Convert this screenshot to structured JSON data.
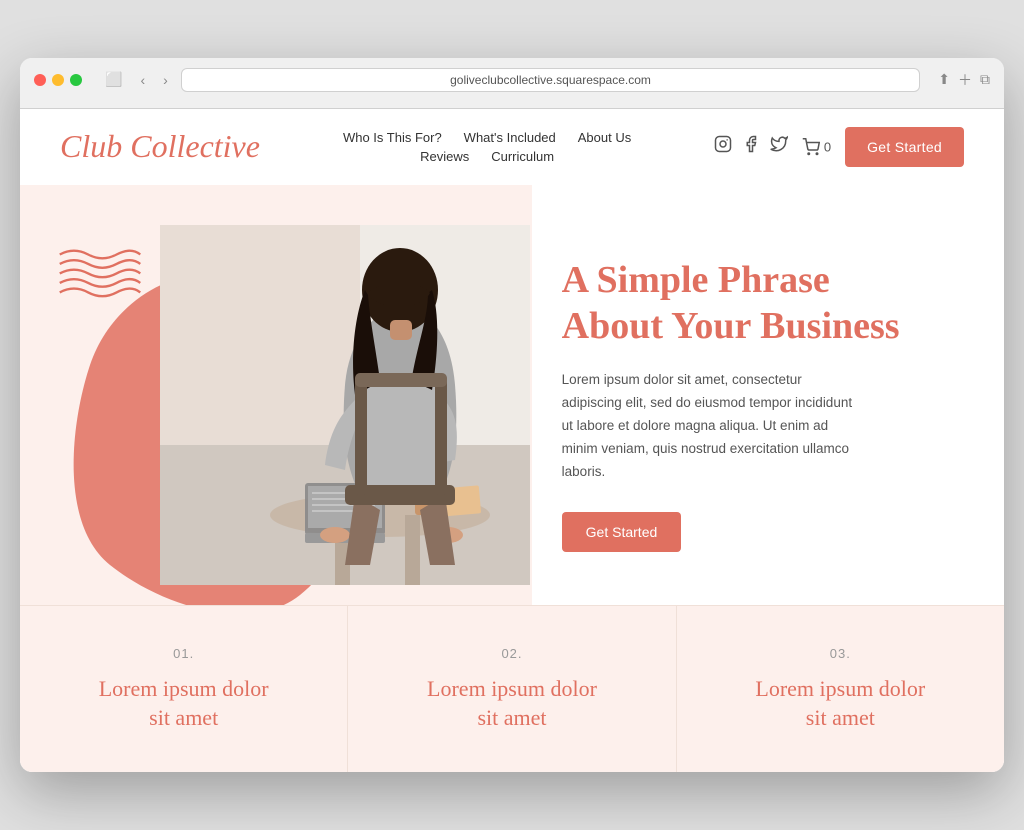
{
  "browser": {
    "url": "goliveclubcollective.squarespace.com",
    "reload_label": "↻"
  },
  "header": {
    "logo": "Club Collective",
    "nav": {
      "row1": [
        {
          "label": "Who Is This For?",
          "id": "who"
        },
        {
          "label": "What's Included",
          "id": "included"
        },
        {
          "label": "About Us",
          "id": "about"
        }
      ],
      "row2": [
        {
          "label": "Reviews",
          "id": "reviews"
        },
        {
          "label": "Curriculum",
          "id": "curriculum"
        }
      ]
    },
    "cart_label": "🛒 0",
    "cta_label": "Get Started"
  },
  "hero": {
    "heading_line1": "A Simple Phrase",
    "heading_line2": "About Your Business",
    "body": "Lorem ipsum dolor sit amet, consectetur adipiscing elit, sed do eiusmod tempor incididunt ut labore et dolore magna aliqua. Ut enim ad minim veniam, quis nostrud exercitation ullamco laboris.",
    "cta_label": "Get Started"
  },
  "features": [
    {
      "number": "01.",
      "title_line1": "Lorem ipsum dolor",
      "title_line2": "sit amet"
    },
    {
      "number": "02.",
      "title_line1": "Lorem ipsum dolor",
      "title_line2": "sit amet"
    },
    {
      "number": "03.",
      "title_line1": "Lorem ipsum dolor",
      "title_line2": "sit amet"
    }
  ],
  "colors": {
    "brand": "#e07060",
    "bg_light": "#fdf0ec"
  }
}
